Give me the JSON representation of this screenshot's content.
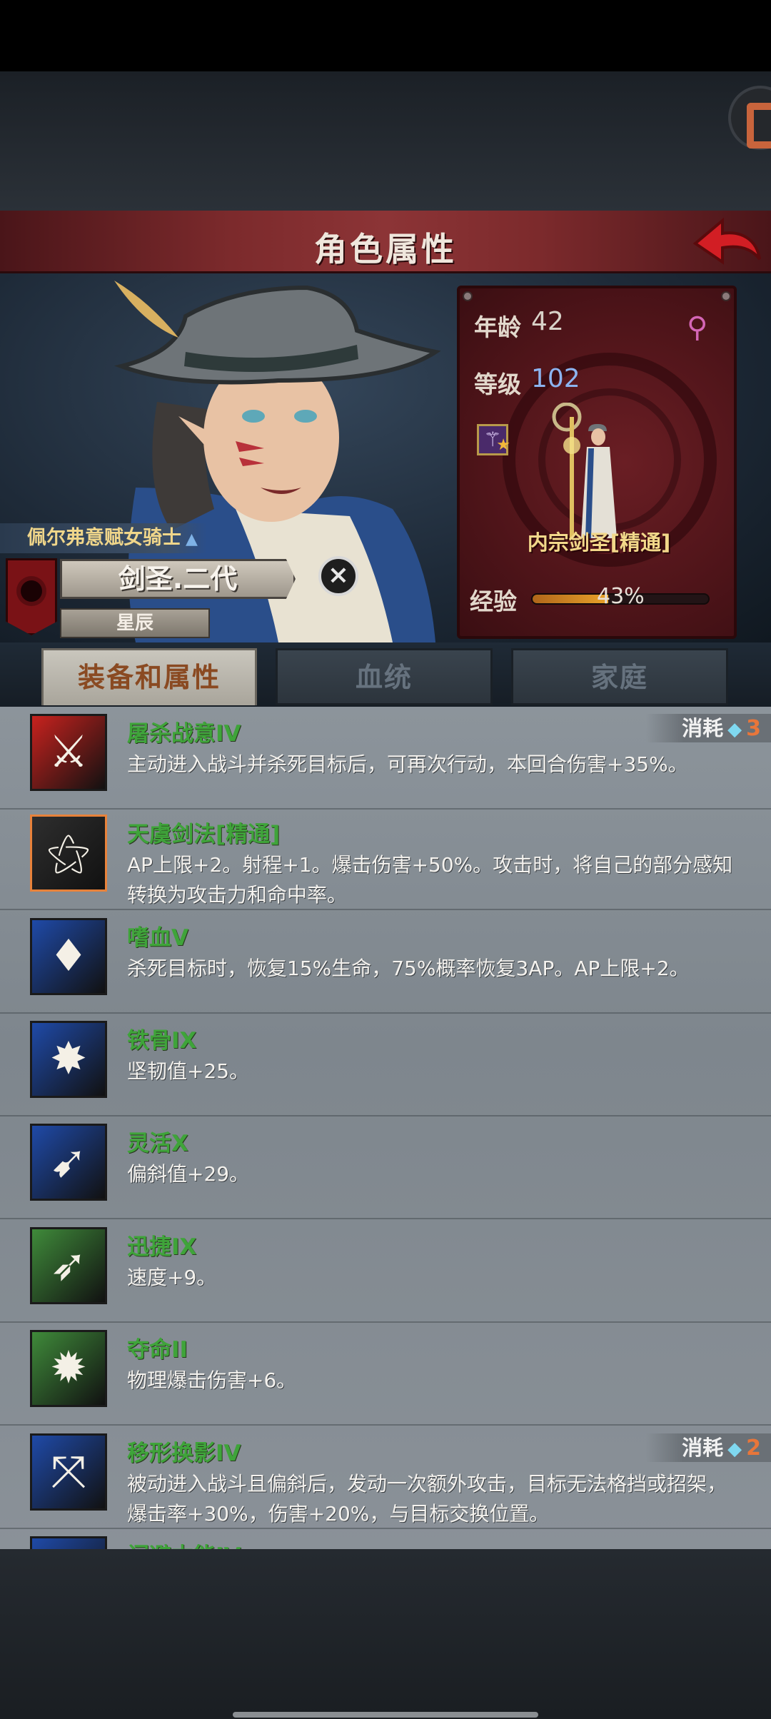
{
  "header": {
    "title": "角色属性"
  },
  "character": {
    "title_tag": "佩尔弗意赋女骑士",
    "name": "剑圣.二代",
    "subtitle": "星辰"
  },
  "stats": {
    "age_label": "年龄",
    "age_value": "42",
    "level_label": "等级",
    "level_value": "102",
    "class_name": "内宗剑圣[精通]",
    "exp_label": "经验",
    "exp_percent_text": "43%",
    "exp_fraction": 0.43
  },
  "tabs": [
    {
      "label": "装备和属性",
      "active": true
    },
    {
      "label": "血统",
      "active": false
    },
    {
      "label": "家庭",
      "active": false
    }
  ],
  "cost_label": "消耗",
  "skills": [
    {
      "name": "屠杀战意IV",
      "desc": "主动进入战斗并杀死目标后，可再次行动，本回合伤害+35%。",
      "cost": "3",
      "icon": "slaughter-icon",
      "color": "#c8221e"
    },
    {
      "name": "天虞剑法[精通]",
      "desc": "AP上限+2。射程+1。爆击伤害+50%。攻击时，将自己的部分感知转换为攻击力和命中率。",
      "icon": "sword-art-icon",
      "color": "#2e2e2e"
    },
    {
      "name": "嗜血V",
      "desc": "杀死目标时，恢复15%生命，75%概率恢复3AP。AP上限+2。",
      "icon": "bloodthirst-icon",
      "color": "#1f4aa8"
    },
    {
      "name": "铁骨IX",
      "desc": "坚韧值+25。",
      "icon": "iron-bone-icon",
      "color": "#1f4aa8"
    },
    {
      "name": "灵活X",
      "desc": "偏斜值+29。",
      "icon": "agility-icon",
      "color": "#1f4aa8"
    },
    {
      "name": "迅捷IX",
      "desc": "速度+9。",
      "icon": "swift-icon",
      "color": "#3f8a3a"
    },
    {
      "name": "夺命II",
      "desc": "物理爆击伤害+6。",
      "icon": "deadly-icon",
      "color": "#3f8a3a"
    },
    {
      "name": "移形换影IV",
      "desc": "被动进入战斗且偏斜后，发动一次额外攻击，目标无法格挡或招架，爆击率+30%，伤害+20%，与目标交换位置。",
      "cost": "2",
      "icon": "shadow-step-icon",
      "color": "#1f4aa8"
    },
    {
      "name": "闪避本能IV",
      "desc": "",
      "icon": "dodge-icon",
      "color": "#1f4aa8"
    }
  ]
}
